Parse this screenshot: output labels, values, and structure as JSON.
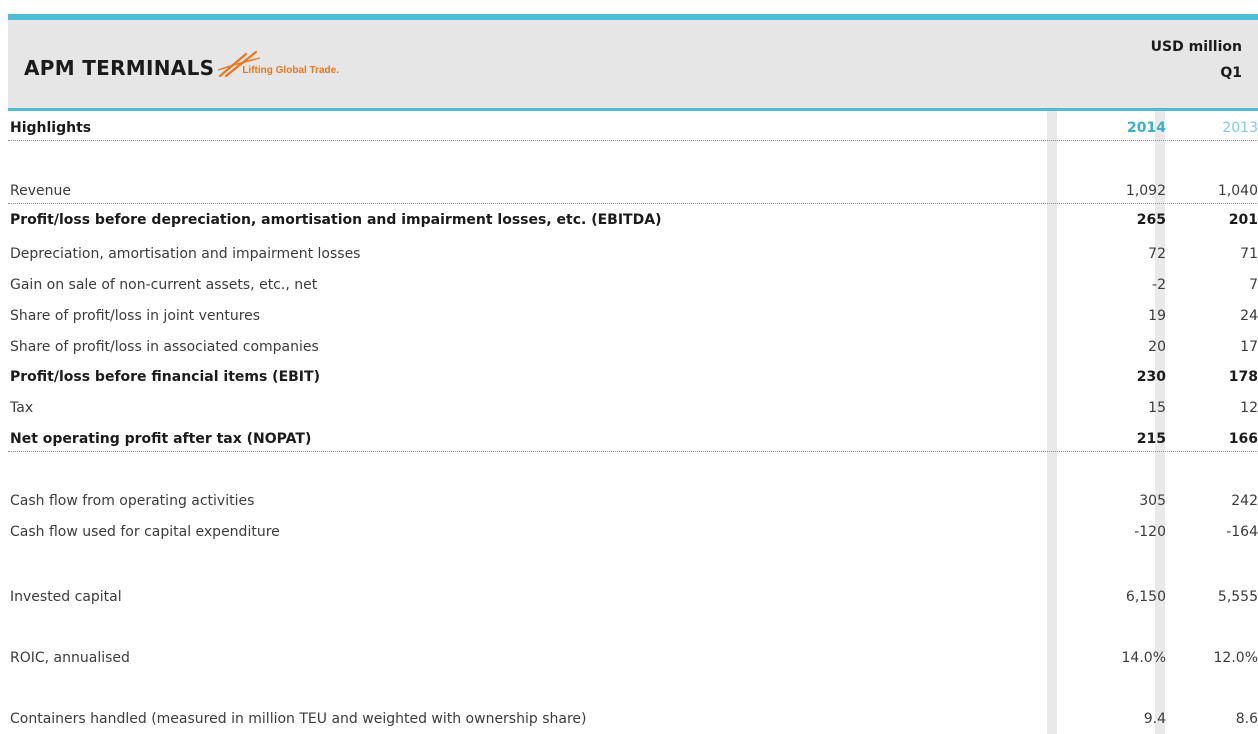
{
  "colors": {
    "accent": "#4fbcd6",
    "year_current": "#3aaed0",
    "year_prior": "#7fcbe0",
    "tagline": "#e8761c"
  },
  "header": {
    "brand": "APM TERMINALS",
    "tagline": "Lifting Global Trade.",
    "units": "USD million",
    "period": "Q1"
  },
  "table": {
    "title": "Highlights",
    "year_current": "2014",
    "year_prior": "2013",
    "rows": [
      {
        "label": "Revenue",
        "v2014": "1,092",
        "v2013": "1,040"
      },
      {
        "label": "Profit/loss before depreciation, amortisation and impairment losses, etc. (EBITDA)",
        "v2014": "265",
        "v2013": "201"
      },
      {
        "label": "Depreciation, amortisation and impairment losses",
        "v2014": "72",
        "v2013": "71"
      },
      {
        "label": "Gain on sale of non-current assets, etc., net",
        "v2014": "-2",
        "v2013": "7"
      },
      {
        "label": "Share of profit/loss in joint ventures",
        "v2014": "19",
        "v2013": "24"
      },
      {
        "label": "Share of profit/loss in associated companies",
        "v2014": "20",
        "v2013": "17"
      },
      {
        "label": "Profit/loss before financial items (EBIT)",
        "v2014": "230",
        "v2013": "178"
      },
      {
        "label": "Tax",
        "v2014": "15",
        "v2013": "12"
      },
      {
        "label": "Net operating profit after tax (NOPAT)",
        "v2014": "215",
        "v2013": "166"
      },
      {
        "label": "Cash flow from operating activities",
        "v2014": "305",
        "v2013": "242"
      },
      {
        "label": "Cash flow used for capital expenditure",
        "v2014": "-120",
        "v2013": "-164"
      },
      {
        "label": "Invested capital",
        "v2014": "6,150",
        "v2013": "5,555"
      },
      {
        "label": "ROIC, annualised",
        "v2014": "14.0%",
        "v2013": "12.0%"
      },
      {
        "label": "Containers handled (measured in million TEU and weighted with ownership share)",
        "v2014": "9.4",
        "v2013": "8.6"
      }
    ]
  }
}
